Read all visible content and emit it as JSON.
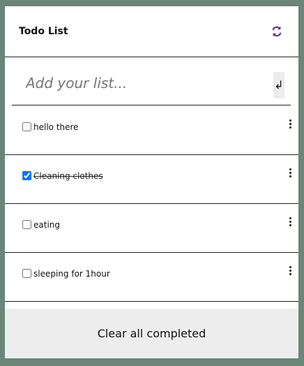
{
  "header": {
    "title": "Todo List",
    "refresh_icon": "refresh-icon",
    "accent": "#6a2c91"
  },
  "input": {
    "placeholder": "Add your list...",
    "value": "",
    "enter_symbol": "↲"
  },
  "items": [
    {
      "label": "hello there",
      "completed": false
    },
    {
      "label": "Cleaning clothes",
      "completed": true
    },
    {
      "label": "eating",
      "completed": false
    },
    {
      "label": "sleeping for 1hour",
      "completed": false
    }
  ],
  "footer": {
    "clear_label": "Clear all completed"
  }
}
